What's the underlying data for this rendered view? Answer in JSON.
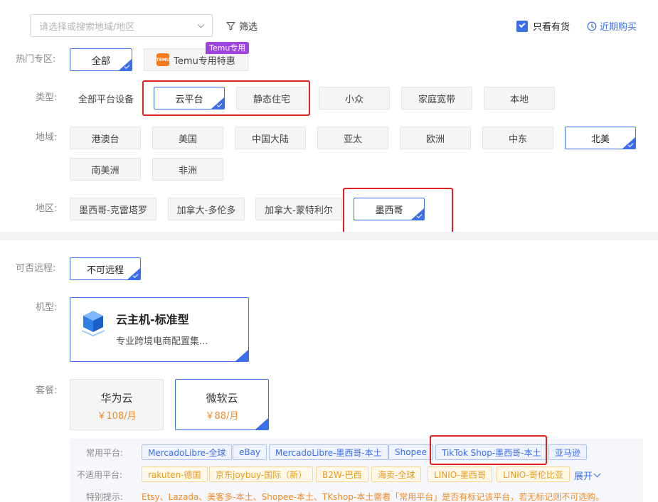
{
  "filter": {
    "search_placeholder": "请选择或搜索地域/地区",
    "filter_label": "筛选",
    "in_stock_label": "只看有货",
    "recent_label": "近期购买"
  },
  "hot": {
    "label": "热门专区:",
    "all": "全部",
    "temu": "Temu专用特惠",
    "temu_badge": "Temu专用",
    "temu_logo": "TEMU"
  },
  "type": {
    "label": "类型:",
    "items": [
      "全部平台设备",
      "云平台",
      "静态住宅",
      "小众",
      "家庭宽带",
      "本地"
    ]
  },
  "region": {
    "label": "地域:",
    "items": [
      "港澳台",
      "美国",
      "中国大陆",
      "亚太",
      "欧洲",
      "中东",
      "北美",
      "南美洲",
      "非洲"
    ]
  },
  "area": {
    "label": "地区:",
    "items": [
      "墨西哥-克雷塔罗",
      "加拿大-多伦多",
      "加拿大-蒙特利尔",
      "墨西哥"
    ]
  },
  "remote": {
    "label": "可否远程:",
    "value": "不可远程"
  },
  "model": {
    "label": "机型:",
    "title": "云主机-标准型",
    "desc": "专业跨境电商配置集..."
  },
  "package": {
    "label": "套餐:",
    "items": [
      {
        "name": "华为云",
        "price": "￥108/月"
      },
      {
        "name": "微软云",
        "price": "￥88/月"
      }
    ]
  },
  "platforms": {
    "common_label": "常用平台:",
    "common": [
      "MercadoLibre-全球",
      "eBay",
      "MercadoLibre-墨西哥-本土",
      "Shopee",
      "TikTok Shop-墨西哥-本土",
      "亚马逊"
    ],
    "unsuitable_label": "不适用平台:",
    "unsuitable": [
      "rakuten-德国",
      "京东joybuy-国际（新）",
      "B2W-巴西",
      "海卖-全球",
      "LINIO-墨西哥",
      "LINIO-哥伦比亚"
    ],
    "expand": "展开",
    "note_label": "特别提示:",
    "note": "Etsy、Lazada、美客多-本土、Shopee-本土、TKshop-本土需看「常用平台」是否有标记该平台，若无标记则不可选购。"
  },
  "colors": {
    "accent": "#3d6eea",
    "highlight": "#e32222",
    "price": "#f08a24",
    "warning": "#e39a1f"
  }
}
